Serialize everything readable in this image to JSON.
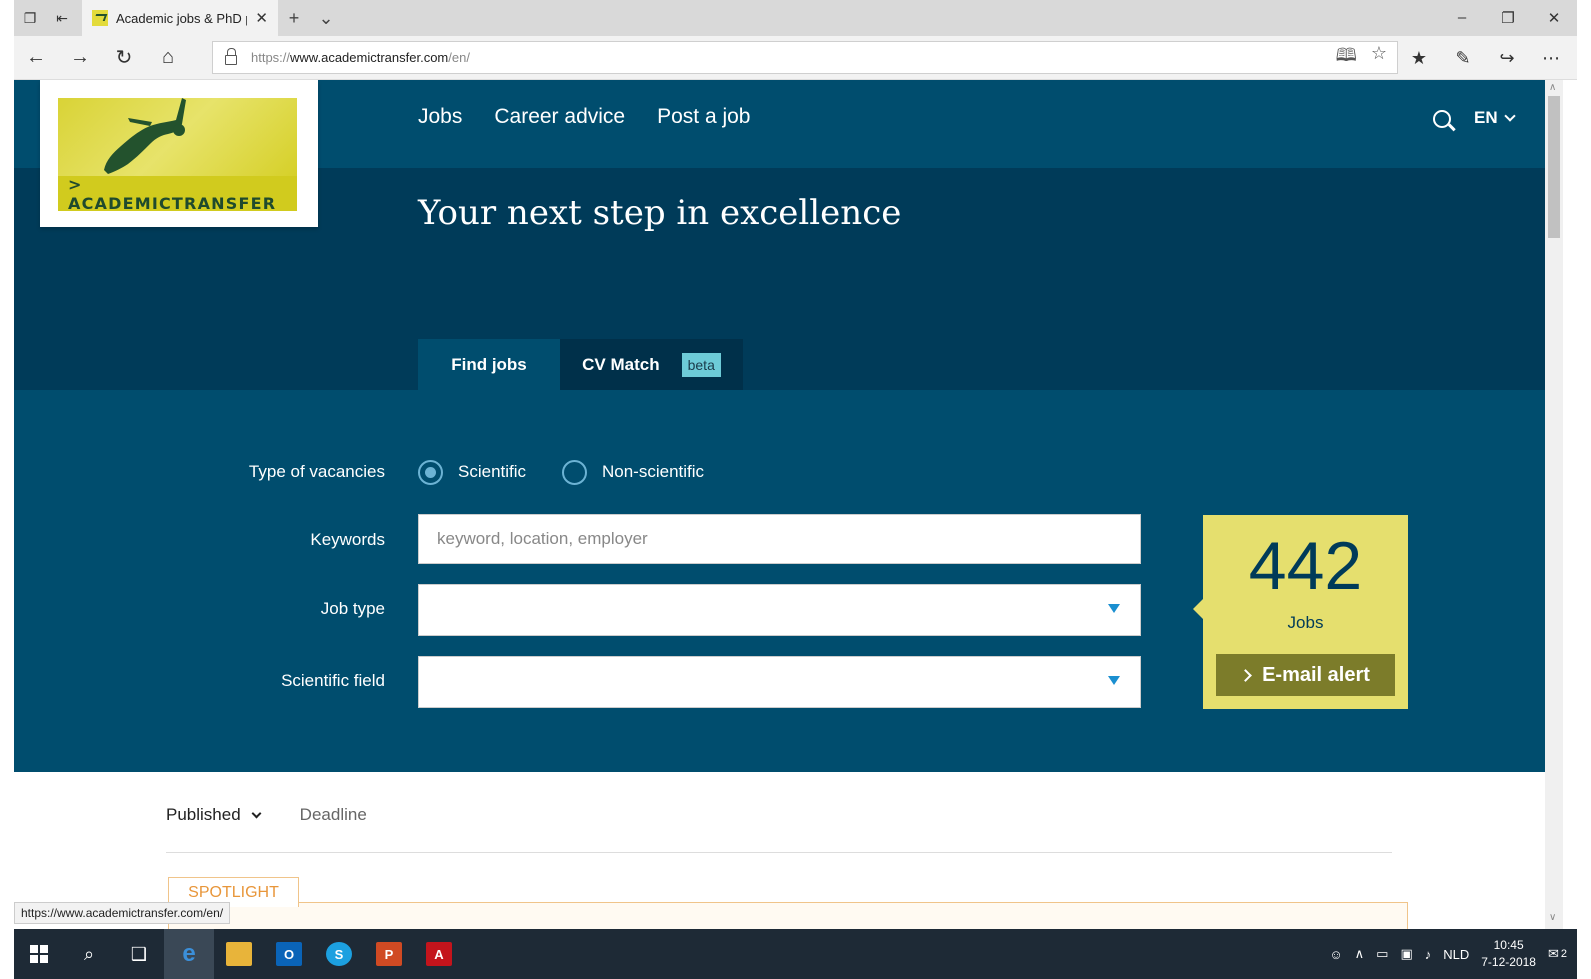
{
  "browser": {
    "tab_title": "Academic jobs & PhD p",
    "url_prefix": "https://",
    "url_domain": "www.academictransfer.com",
    "url_path": "/en/",
    "status_url": "https://www.academictransfer.com/en/"
  },
  "header": {
    "logo_text": "> ACADEMICTRANSFER",
    "nav": [
      "Jobs",
      "Career advice",
      "Post a job"
    ],
    "language": "EN"
  },
  "hero": {
    "title": "Your next step in excellence",
    "tabs": {
      "find": "Find jobs",
      "cv": "CV Match",
      "beta": "beta"
    }
  },
  "search": {
    "type_label": "Type of vacancies",
    "radio_scientific": "Scientific",
    "radio_nonscientific": "Non-scientific",
    "selected": "Scientific",
    "keywords_label": "Keywords",
    "keywords_placeholder": "keyword, location, employer",
    "keywords_value": "",
    "jobtype_label": "Job type",
    "jobtype_value": "",
    "field_label": "Scientific field",
    "field_value": ""
  },
  "counter": {
    "count": "442",
    "label": "Jobs",
    "alert_button": "E-mail alert"
  },
  "results": {
    "sort_published": "Published",
    "sort_deadline": "Deadline",
    "spotlight": "SPOTLIGHT"
  },
  "taskbar": {
    "language": "NLD",
    "time": "10:45",
    "date": "7-12-2018",
    "notifications": "2"
  },
  "colors": {
    "header_bg": "#004d6e",
    "hero_bg": "#003b59",
    "accent_yellow": "#e5df6e",
    "alert_button_bg": "#7c7c2a",
    "spotlight_orange": "#e8963a"
  }
}
